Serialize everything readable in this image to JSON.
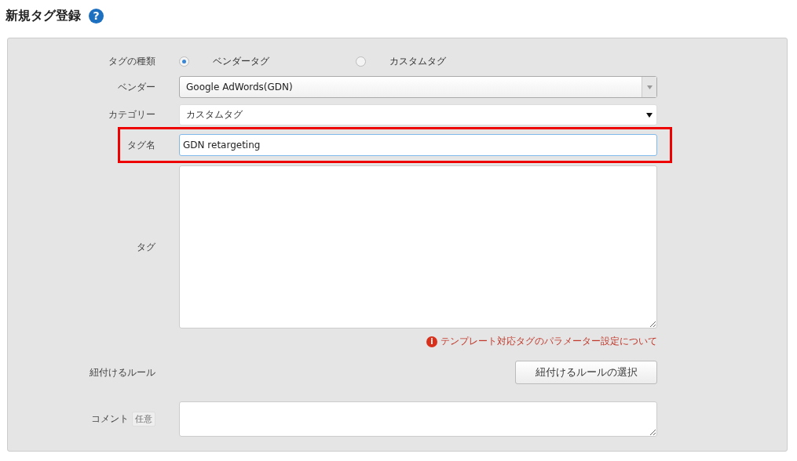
{
  "page": {
    "title": "新規タグ登録",
    "help": "?"
  },
  "form": {
    "tag_type": {
      "label": "タグの種類",
      "options": [
        {
          "label": "ベンダータグ",
          "selected": true
        },
        {
          "label": "カスタムタグ",
          "selected": false
        }
      ]
    },
    "vendor": {
      "label": "ベンダー",
      "value": "Google AdWords(GDN)"
    },
    "category": {
      "label": "カテゴリー",
      "value": "カスタムタグ"
    },
    "tag_name": {
      "label": "タグ名",
      "value": "GDN retargeting",
      "highlighted": true,
      "focused": true
    },
    "tag": {
      "label": "タグ"
    },
    "help_link": {
      "icon": "i",
      "text": "テンプレート対応タグのパラメーター設定について"
    },
    "rule": {
      "label": "紐付けるルール",
      "button": "紐付けるルールの選択"
    },
    "comment": {
      "label": "コメント",
      "badge": "任意"
    }
  }
}
